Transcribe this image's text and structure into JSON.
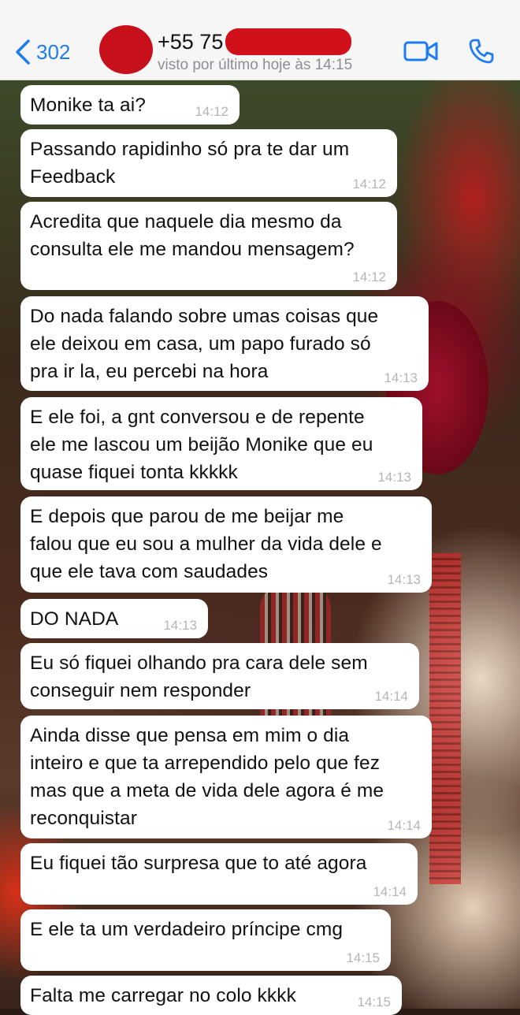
{
  "header": {
    "back_count": "302",
    "contact_name": "+55 75",
    "last_seen": "visto por último hoje às 14:15"
  },
  "messages": [
    {
      "text": "Monike ta ai?",
      "time": "14:12"
    },
    {
      "text": "Passando rapidinho só pra te dar um\nFeedback",
      "time": "14:12"
    },
    {
      "text": "Acredita que naquele dia mesmo da\nconsulta ele me mandou mensagem?",
      "time": "14:12"
    },
    {
      "text": "Do nada falando sobre umas coisas que\nele deixou em casa, um papo furado só\npra ir la, eu percebi na hora",
      "time": "14:13"
    },
    {
      "text": "E ele foi, a gnt conversou e de repente\nele me lascou um beijão Monike que eu\nquase fiquei tonta kkkkk",
      "time": "14:13"
    },
    {
      "text": "E depois que parou de me beijar me\nfalou que eu sou a mulher da vida dele e\nque ele tava com saudades",
      "time": "14:13"
    },
    {
      "text": "DO NADA",
      "time": "14:13"
    },
    {
      "text": "Eu só fiquei olhando pra cara dele sem\nconseguir nem responder",
      "time": "14:14"
    },
    {
      "text": "Ainda disse que pensa em mim o dia\ninteiro e que ta arrependido pelo que fez\nmas que a meta de vida dele agora é me\nreconquistar",
      "time": "14:14"
    },
    {
      "text": "Eu fiquei tão surpresa que to até agora",
      "time": "14:14"
    },
    {
      "text": "E ele ta um verdadeiro príncipe cmg",
      "time": "14:15"
    },
    {
      "text": "Falta me carregar no colo kkkk",
      "time": "14:15"
    }
  ],
  "colors": {
    "accent": "#1d7cf2",
    "bubble": "#ffffff",
    "timestamp": "#b5b5b8",
    "redaction": "#d0101a"
  },
  "icons": {
    "back": "chevron-left-icon",
    "video": "video-camera-icon",
    "call": "phone-icon"
  }
}
